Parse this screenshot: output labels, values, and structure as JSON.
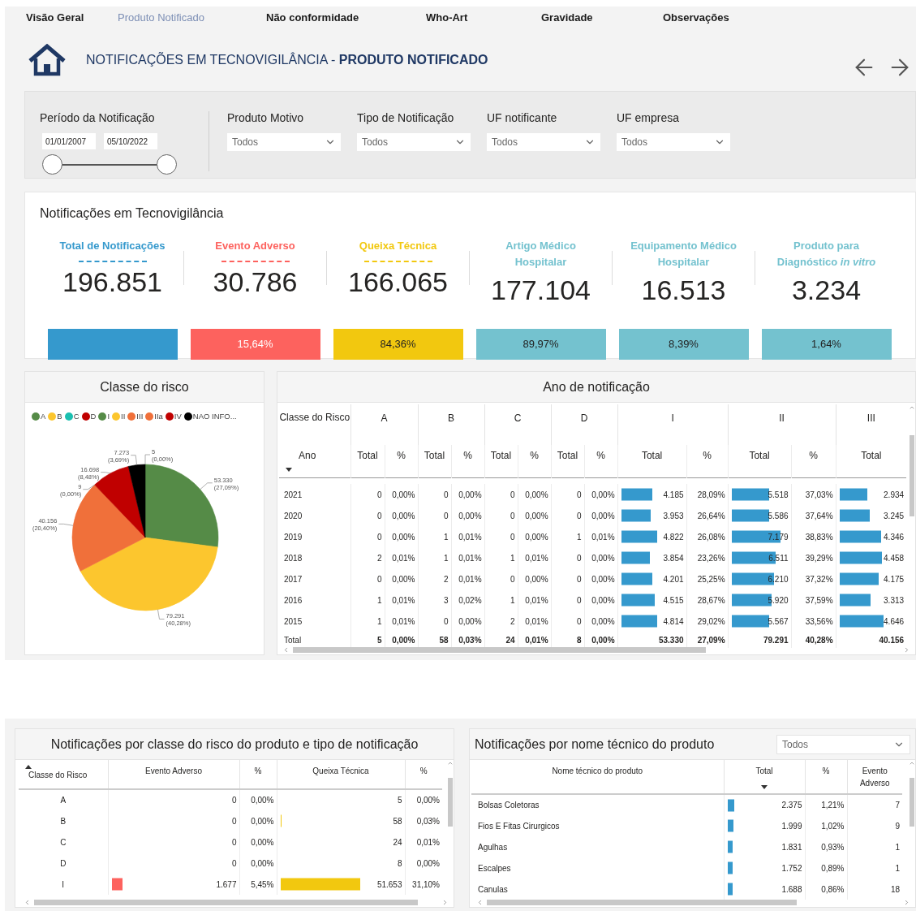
{
  "nav": [
    {
      "label": "Visão Geral",
      "selected": false
    },
    {
      "label": "Produto Notificado",
      "selected": true
    },
    {
      "label": "Não conformidade",
      "selected": false
    },
    {
      "label": "Who-Art",
      "selected": false
    },
    {
      "label": "Gravidade",
      "selected": false
    },
    {
      "label": "Observações",
      "selected": false
    }
  ],
  "header": {
    "title": "NOTIFICAÇÕES EM TECNOVIGILÂNCIA - **PRODUTO NOTIFICADO**"
  },
  "filters": {
    "period": {
      "label": "Período da Notificação",
      "start": "01/01/2007",
      "end": "05/10/2022"
    },
    "dropdowns": [
      {
        "label": "Produto Motivo",
        "value": "Todos"
      },
      {
        "label": "Tipo de Notificação",
        "value": "Todos"
      },
      {
        "label": "UF notificante",
        "value": "Todos"
      },
      {
        "label": "UF empresa",
        "value": "Todos"
      }
    ]
  },
  "kpis": {
    "title": "Notificações em Tecnovigilância",
    "items": [
      {
        "label": "Total de Notificações",
        "value": "196.851",
        "color": "#3599cd",
        "underline": true
      },
      {
        "label": "Evento Adverso",
        "value": "30.786",
        "color": "#fd625e",
        "underline": true,
        "percent": "15,64%"
      },
      {
        "label": "Queixa Técnica",
        "value": "166.065",
        "color": "#f2c80f",
        "underline": true,
        "percent": "84,36%"
      },
      {
        "label": "Artigo Médico Hospitalar",
        "value": "177.104",
        "color": "#74c2cf",
        "underline": false,
        "percent": "89,97%"
      },
      {
        "label": "Equipamento Médico Hospitalar",
        "value": "16.513",
        "color": "#74c2cf",
        "underline": false,
        "percent": "8,39%"
      },
      {
        "label": "Produto para Diagnóstico *in vitro*",
        "value": "3.234",
        "color": "#74c2cf",
        "underline": false,
        "percent": "1,64%"
      }
    ]
  },
  "risk_pie": {
    "legend": [
      {
        "label": "A",
        "color": "#558b47"
      },
      {
        "label": "B",
        "color": "#fcc62e"
      },
      {
        "label": "C",
        "color": "#1bbfb0"
      },
      {
        "label": "D",
        "color": "#c00000"
      },
      {
        "label": "I",
        "color": "#558b47"
      },
      {
        "label": "II",
        "color": "#fcc62e"
      },
      {
        "label": "III",
        "color": "#f0703a"
      },
      {
        "label": "IIa",
        "color": "#f0703a"
      },
      {
        "label": "IV",
        "color": "#c00000"
      },
      {
        "label": "NAO INFO...",
        "color": "#000000"
      }
    ],
    "chart_data": {
      "type": "pie",
      "title": "Classe do risco",
      "colors": [
        "#558b47",
        "#fcc62e",
        "#f0703a",
        "#c00000",
        "#000000"
      ],
      "values": [
        53330,
        79291,
        40156,
        16698,
        7273
      ],
      "value_labels": [
        "53.330 (27,09%)",
        "79.291 (40,28%)",
        "40.156 (20,40%)",
        "16.698 (8,48%)",
        "7.273 (3,69%)"
      ]
    },
    "small_slice_labels": [
      "5 (0,00%)",
      "9 (0,00%)"
    ]
  },
  "year_table": {
    "title": "Ano de notificação",
    "corner_top": "Classe do Risco",
    "corner_bottom": "Ano",
    "sort_desc": true,
    "groups": [
      {
        "name": "A",
        "columns": [
          "Total",
          "%"
        ]
      },
      {
        "name": "B",
        "columns": [
          "Total",
          "%"
        ]
      },
      {
        "name": "C",
        "columns": [
          "Total",
          "%"
        ]
      },
      {
        "name": "D",
        "columns": [
          "Total",
          "%"
        ]
      },
      {
        "name": "I",
        "columns": [
          "Total",
          "%"
        ]
      },
      {
        "name": "II",
        "columns": [
          "Total",
          "%"
        ]
      },
      {
        "name": "III",
        "columns": [
          "Total"
        ]
      }
    ],
    "rows": [
      {
        "label": "2021",
        "cells": [
          "0",
          "0,00%",
          "0",
          "0,00%",
          "0",
          "0,00%",
          "0",
          "0,00%",
          {
            "text": "4.185",
            "level": 0.51
          },
          "28,09%",
          {
            "text": "5.518",
            "level": 0.67
          },
          "37,03%",
          {
            "text": "2.934",
            "level": 0.44
          }
        ]
      },
      {
        "label": "2020",
        "cells": [
          "0",
          "0,00%",
          "0",
          "0,00%",
          "0",
          "0,00%",
          "0",
          "0,00%",
          {
            "text": "3.953",
            "level": 0.48
          },
          "26,64%",
          {
            "text": "5.586",
            "level": 0.68
          },
          "37,64%",
          {
            "text": "3.245",
            "level": 0.48
          }
        ]
      },
      {
        "label": "2019",
        "cells": [
          "0",
          "0,00%",
          "1",
          "0,01%",
          "0",
          "0,00%",
          "1",
          "0,01%",
          {
            "text": "4.822",
            "level": 0.59
          },
          "26,08%",
          {
            "text": "7.179",
            "level": 0.87
          },
          "38,83%",
          {
            "text": "4.346",
            "level": 0.65
          }
        ]
      },
      {
        "label": "2018",
        "cells": [
          "2",
          "0,01%",
          "1",
          "0,01%",
          "1",
          "0,01%",
          "0",
          "0,00%",
          {
            "text": "3.854",
            "level": 0.47
          },
          "23,26%",
          {
            "text": "6.511",
            "level": 0.79
          },
          "39,29%",
          {
            "text": "4.458",
            "level": 0.67
          }
        ]
      },
      {
        "label": "2017",
        "cells": [
          "0",
          "0,00%",
          "2",
          "0,01%",
          "0",
          "0,00%",
          "0",
          "0,00%",
          {
            "text": "4.201",
            "level": 0.51
          },
          "25,25%",
          {
            "text": "6.210",
            "level": 0.76
          },
          "37,32%",
          {
            "text": "4.175",
            "level": 0.62
          }
        ]
      },
      {
        "label": "2016",
        "cells": [
          "1",
          "0,01%",
          "3",
          "0,02%",
          "1",
          "0,01%",
          "0",
          "0,00%",
          {
            "text": "4.515",
            "level": 0.55
          },
          "28,67%",
          {
            "text": "5.920",
            "level": 0.72
          },
          "37,59%",
          {
            "text": "3.313",
            "level": 0.49
          }
        ]
      },
      {
        "label": "2015",
        "cells": [
          "1",
          "0,01%",
          "0",
          "0,00%",
          "2",
          "0,01%",
          "0",
          "0,00%",
          {
            "text": "4.814",
            "level": 0.59
          },
          "29,02%",
          {
            "text": "5.567",
            "level": 0.68
          },
          "33,56%",
          {
            "text": "4.646",
            "level": 0.69
          }
        ]
      }
    ],
    "total": {
      "label": "Total",
      "cells": [
        "5",
        "0,00%",
        "58",
        "0,03%",
        "24",
        "0,01%",
        "8",
        "0,00%",
        "53.330",
        "27,09%",
        "79.291",
        "40,28%",
        "40.156"
      ]
    }
  },
  "risk_table": {
    "title": "Notificações por classe do risco do produto e tipo de notificação",
    "columns": [
      {
        "label": "Classe do Risco",
        "sort_asc": true
      },
      {
        "label": "Evento Adverso"
      },
      {
        "label": "%"
      },
      {
        "label": "Queixa Técnica"
      },
      {
        "label": "%"
      }
    ],
    "rows": [
      [
        "A",
        "0",
        "0,00%",
        "5",
        "0,00%"
      ],
      [
        "B",
        "0",
        "0,00%",
        {
          "text": "58",
          "level": 0.01
        },
        "0,03%"
      ],
      [
        "C",
        "0",
        "0,00%",
        "24",
        "0,01%"
      ],
      [
        "D",
        "0",
        "0,00%",
        "8",
        "0,00%"
      ],
      [
        "I",
        {
          "text": "1.677",
          "level": 0.09
        },
        "5,45%",
        {
          "text": "51.653",
          "level": 0.66
        },
        "31,10%"
      ]
    ]
  },
  "product_table": {
    "title": "Notificações por nome técnico do produto",
    "filter": {
      "value": "Todos"
    },
    "columns": [
      {
        "label": "Nome técnico do produto"
      },
      {
        "label": "Total",
        "sort_desc": true
      },
      {
        "label": "%"
      },
      {
        "label": "Evento Adverso"
      }
    ],
    "rows": [
      [
        "Bolsas Coletoras",
        {
          "text": "2.375",
          "level": 0.09
        },
        "1,21%",
        "7"
      ],
      [
        "Fios E Fitas Cirurgicos",
        {
          "text": "1.999",
          "level": 0.08
        },
        "1,02%",
        "9"
      ],
      [
        "Agulhas",
        {
          "text": "1.831",
          "level": 0.07
        },
        "0,93%",
        "1"
      ],
      [
        "Escalpes",
        {
          "text": "1.752",
          "level": 0.07
        },
        "0,89%",
        "1"
      ],
      [
        "Canulas",
        {
          "text": "1.688",
          "level": 0.07
        },
        "0,86%",
        "18"
      ]
    ]
  }
}
